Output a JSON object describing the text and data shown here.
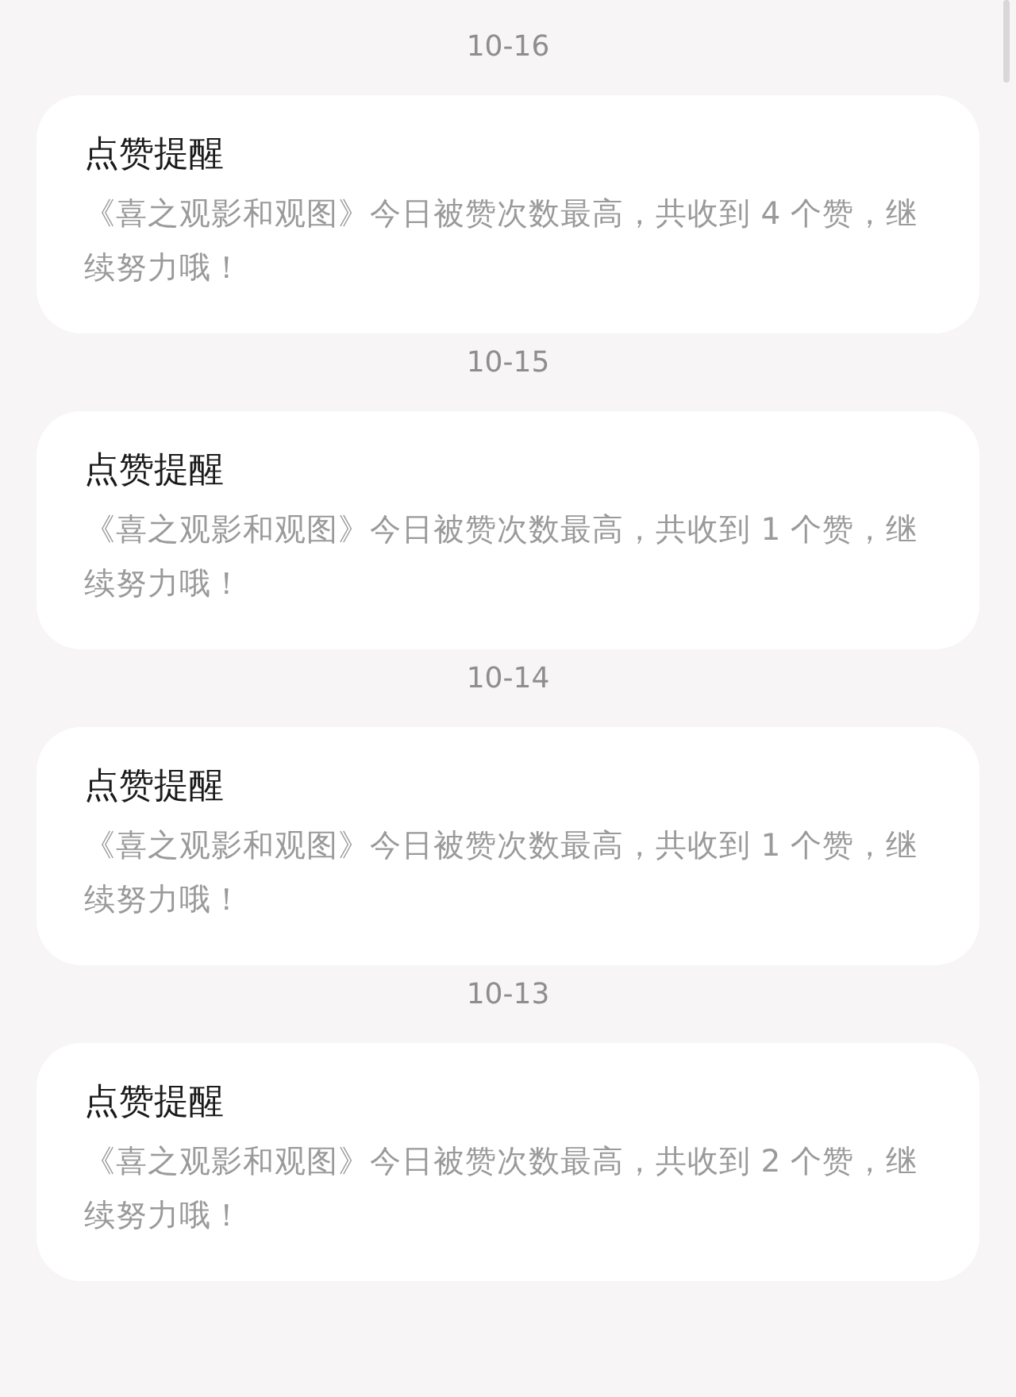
{
  "notifications": [
    {
      "date": "10-16",
      "title": "点赞提醒",
      "message": "《喜之观影和观图》今日被赞次数最高，共收到 4 个赞，继续努力哦！"
    },
    {
      "date": "10-15",
      "title": "点赞提醒",
      "message": "《喜之观影和观图》今日被赞次数最高，共收到 1 个赞，继续努力哦！"
    },
    {
      "date": "10-14",
      "title": "点赞提醒",
      "message": "《喜之观影和观图》今日被赞次数最高，共收到 1 个赞，继续努力哦！"
    },
    {
      "date": "10-13",
      "title": "点赞提醒",
      "message": "《喜之观影和观图》今日被赞次数最高，共收到 2 个赞，继续努力哦！"
    }
  ]
}
